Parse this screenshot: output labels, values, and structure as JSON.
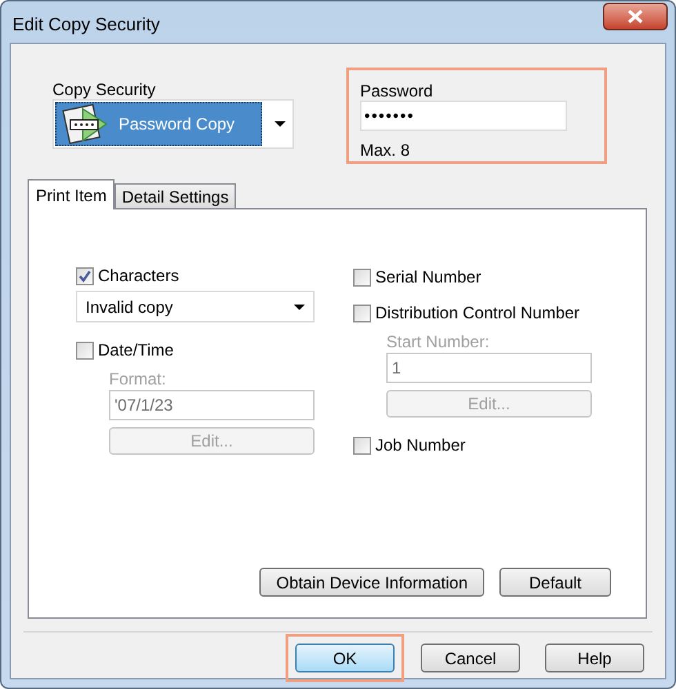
{
  "window": {
    "title": "Edit Copy Security"
  },
  "copy_security": {
    "label": "Copy Security",
    "value": "Password Copy"
  },
  "password": {
    "label": "Password",
    "value": "•••••••",
    "hint": "Max. 8",
    "highlighted": true
  },
  "tabs": [
    {
      "label": "Print Item",
      "selected": true
    },
    {
      "label": "Detail Settings",
      "selected": false
    }
  ],
  "left_items": [
    {
      "kind": "checkbox",
      "label": "Characters",
      "checked": true
    },
    {
      "kind": "dropdown",
      "value": "Invalid copy"
    },
    {
      "kind": "checkbox",
      "label": "Date/Time",
      "checked": false
    },
    {
      "kind": "field",
      "label": "Format:",
      "value": "'07/1/23",
      "disabled": true
    },
    {
      "kind": "button",
      "label": "Edit...",
      "disabled": true
    }
  ],
  "right_items": [
    {
      "kind": "checkbox",
      "label": "Serial Number",
      "checked": false
    },
    {
      "kind": "checkbox",
      "label": "Distribution Control Number",
      "checked": false
    },
    {
      "kind": "field",
      "label": "Start Number:",
      "value": "1",
      "disabled": true
    },
    {
      "kind": "button",
      "label": "Edit...",
      "disabled": true
    },
    {
      "kind": "checkbox",
      "label": "Job Number",
      "checked": false
    }
  ],
  "panel_buttons": [
    {
      "label": "Obtain Device Information"
    },
    {
      "label": "Default"
    }
  ],
  "dialog_buttons": [
    {
      "label": "OK",
      "highlighted": true
    },
    {
      "label": "Cancel",
      "highlighted": false
    },
    {
      "label": "Help",
      "highlighted": false
    }
  ]
}
